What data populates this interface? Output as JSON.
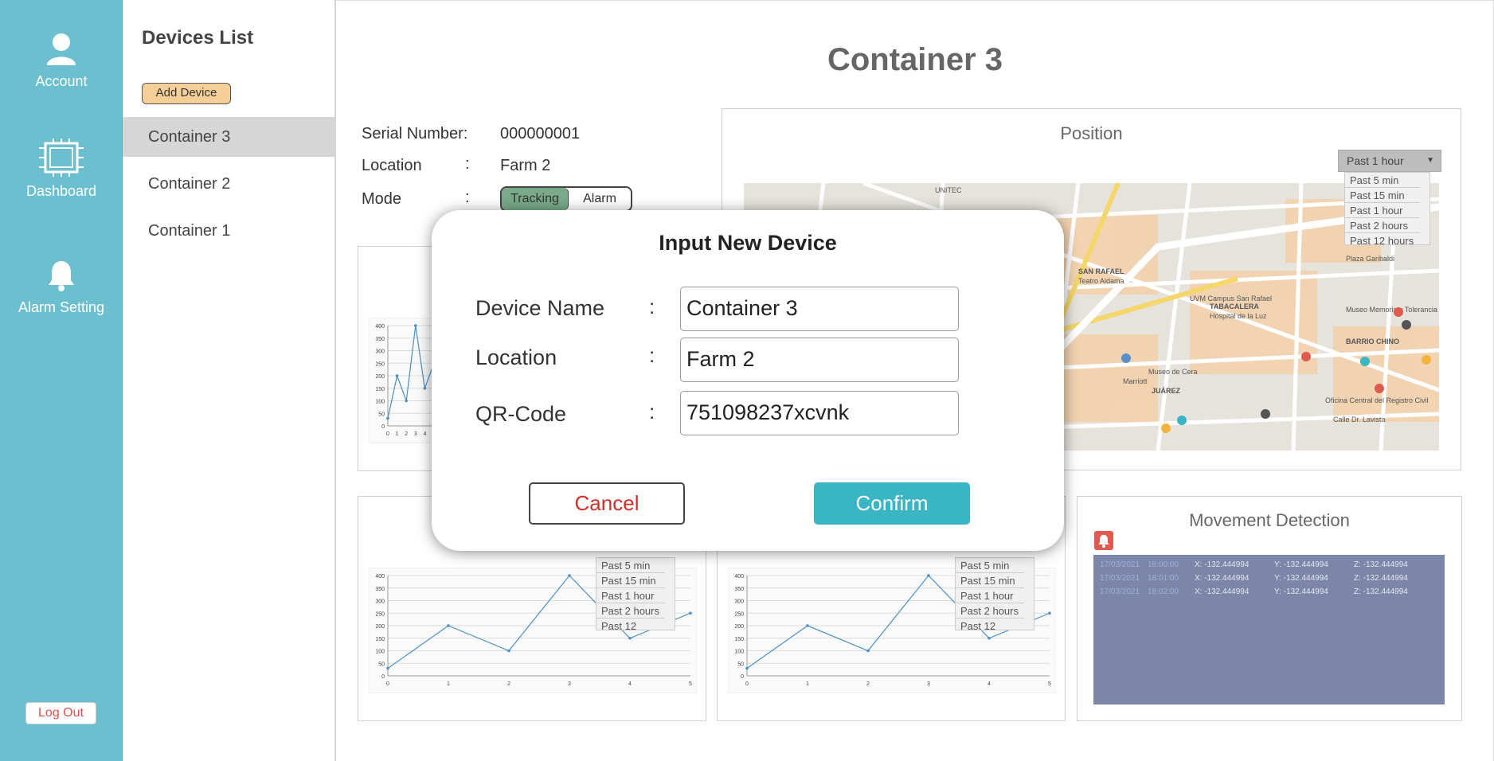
{
  "nav": {
    "account": "Account",
    "dashboard": "Dashboard",
    "alarm_setting": "Alarm Setting",
    "logout": "Log Out"
  },
  "devices": {
    "title": "Devices List",
    "add_button": "Add Device",
    "items": [
      "Container 3",
      "Container 2",
      "Container 1"
    ],
    "selected": "Container 3"
  },
  "detail": {
    "title": "Container 3",
    "serial_label": "Serial Number:",
    "serial_value": "000000001",
    "location_label": "Location",
    "location_colon": ":",
    "location_value": "Farm 2",
    "mode_label": "Mode",
    "mode_colon": ":",
    "mode_on": "Tracking",
    "mode_off": "Alarm"
  },
  "position": {
    "title": "Position",
    "range_selected": "Past 1 hour",
    "range_options": [
      "Past 5 min",
      "Past 15 min",
      "Past 1 hour",
      "Past 2 hours",
      "Past 12 hours"
    ],
    "map_labels": [
      "UNITEC",
      "SAN RAFAEL",
      "Teatro Aldama",
      "UVM Campus San Rafael",
      "TABACALERA",
      "Hospital de la Luz",
      "Museo Memoria y Tolerancia",
      "BARRIO CHINO",
      "Plaza Garibaldi",
      "JUÁREZ",
      "Marriott",
      "Museo de Cera",
      "Oficina Central del Registro Civil",
      "Calle Dr. Lavista"
    ]
  },
  "charts_dropdown": {
    "options": [
      "Past 5 min",
      "Past 15 min",
      "Past 1 hour",
      "Past 2 hours",
      "Past 12 hours"
    ]
  },
  "movement": {
    "title": "Movement Detection",
    "rows": [
      {
        "date": "17/03/2021",
        "time": "18:00:00",
        "x": "X: -132.444994",
        "y": "Y: -132.444994",
        "z": "Z: -132.444994"
      },
      {
        "date": "17/03/2021",
        "time": "18:01:00",
        "x": "X: -132.444994",
        "y": "Y: -132.444994",
        "z": "Z: -132.444994"
      },
      {
        "date": "17/03/2021",
        "time": "18:02:00",
        "x": "X: -132.444994",
        "y": "Y: -132.444994",
        "z": "Z: -132.444994"
      }
    ]
  },
  "modal": {
    "title": "Input New Device",
    "fields": [
      {
        "label": "Device Name",
        "colon": ":",
        "value": "Container 3"
      },
      {
        "label": "Location",
        "colon": ":",
        "value": "Farm 2"
      },
      {
        "label": "QR-Code",
        "colon": ":",
        "value": "751098237xcvnk"
      }
    ],
    "cancel": "Cancel",
    "confirm": "Confirm"
  },
  "chart_data": [
    {
      "type": "line",
      "x": [
        0,
        1,
        2,
        3,
        4,
        5
      ],
      "values": [
        30,
        200,
        100,
        400,
        150,
        250
      ],
      "ylim": [
        0,
        400
      ],
      "yticks": [
        0,
        50,
        100,
        150,
        200,
        250,
        300,
        350,
        400
      ],
      "xticks": [
        0,
        1,
        2,
        3,
        4,
        5
      ],
      "title": "",
      "xlabel": "",
      "ylabel": ""
    },
    {
      "type": "line",
      "x": [
        0,
        1,
        2,
        3,
        4,
        5
      ],
      "values": [
        30,
        200,
        100,
        400,
        150,
        250
      ],
      "ylim": [
        0,
        400
      ],
      "yticks": [
        0,
        50,
        100,
        150,
        200,
        250,
        300,
        350,
        400
      ],
      "xticks": [
        0,
        1,
        2,
        3,
        4,
        5
      ],
      "title": "",
      "xlabel": "",
      "ylabel": ""
    },
    {
      "type": "line",
      "x": [
        0,
        1,
        2,
        3,
        4,
        5
      ],
      "values": [
        30,
        200,
        100,
        400,
        150,
        250
      ],
      "ylim": [
        0,
        400
      ],
      "yticks": [
        0,
        50,
        100,
        150,
        200,
        250,
        300,
        350,
        400
      ],
      "xticks": [
        0,
        1,
        2,
        3,
        4,
        5
      ],
      "title": "",
      "xlabel": "",
      "ylabel": ""
    }
  ]
}
